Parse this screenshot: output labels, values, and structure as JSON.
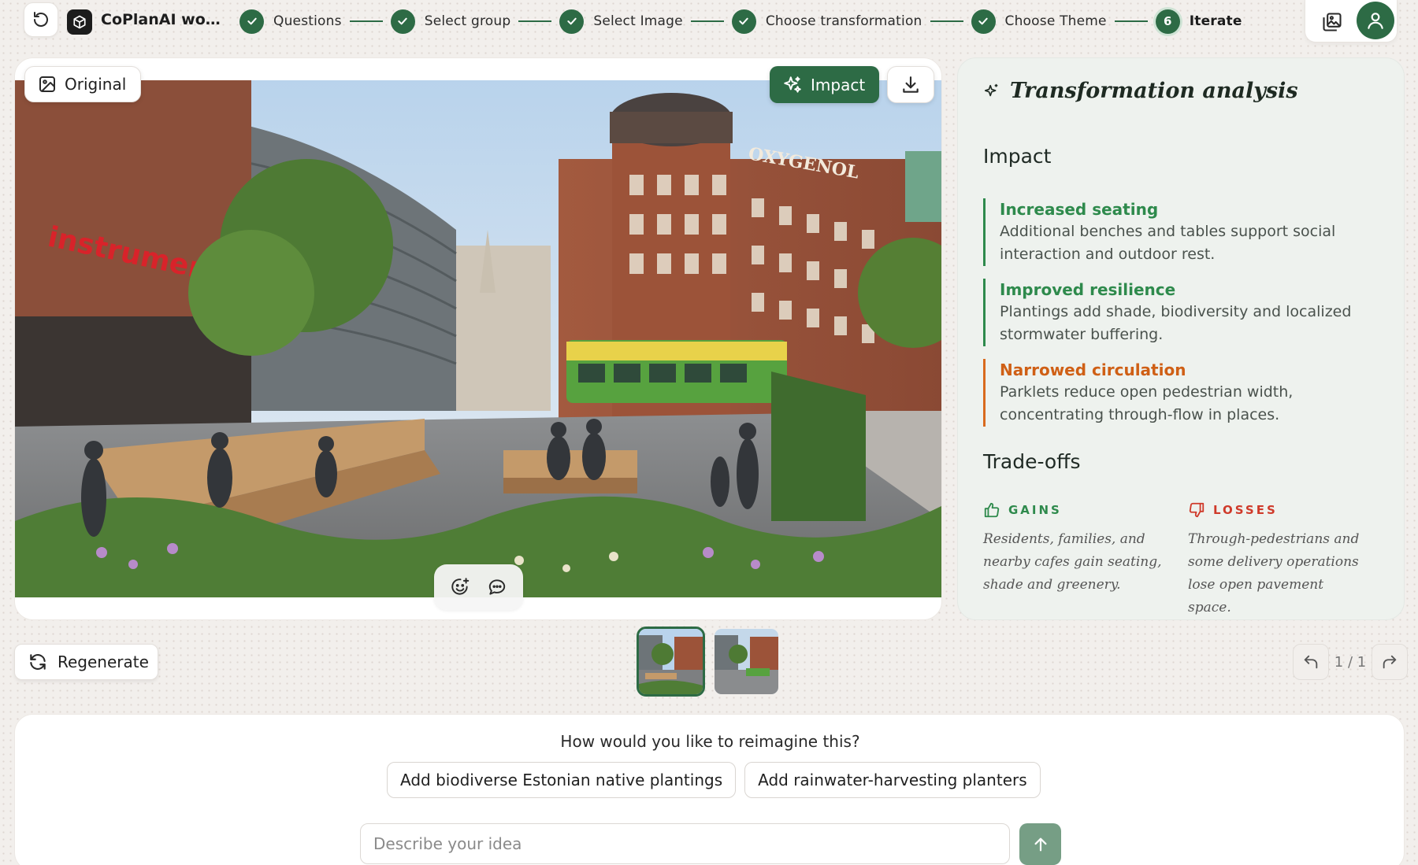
{
  "header": {
    "workspace_title": "CoPlanAI work...",
    "steps": [
      {
        "label": "Questions",
        "done": true
      },
      {
        "label": "Select group",
        "done": true
      },
      {
        "label": "Select Image",
        "done": true
      },
      {
        "label": "Choose transformation",
        "done": true
      },
      {
        "label": "Choose Theme",
        "done": true
      },
      {
        "label": "Iterate",
        "number": "6",
        "current": true
      }
    ],
    "accent_color": "#2d6b45"
  },
  "image_panel": {
    "original_label": "Original",
    "impact_label": "Impact",
    "scene_signs": {
      "shop": "instrumentarium",
      "building": "OXYGENOL"
    }
  },
  "analysis": {
    "title": "Transformation analysis",
    "impact_heading": "Impact",
    "impacts": [
      {
        "title": "Increased seating",
        "description": "Additional benches and tables support social interaction and outdoor rest.",
        "tone": "positive",
        "color": "#2e8a4c"
      },
      {
        "title": "Improved resilience",
        "description": "Plantings add shade, biodiversity and localized stormwater buffering.",
        "tone": "positive",
        "color": "#2e8a4c"
      },
      {
        "title": "Narrowed circulation",
        "description": "Parklets reduce open pedestrian width, concentrating through-flow in places.",
        "tone": "negative",
        "color": "#cf5f15"
      }
    ],
    "tradeoffs_heading": "Trade-offs",
    "gains": {
      "label": "GAINS",
      "text": "Residents, families, and nearby cafes gain seating, shade and greenery."
    },
    "losses": {
      "label": "LOSSES",
      "text": "Through-pedestrians and some delivery operations lose open pavement space."
    }
  },
  "controls": {
    "regenerate_label": "Regenerate",
    "pager": "1 / 1"
  },
  "prompt": {
    "question": "How would you like to reimagine this?",
    "suggestions": [
      "Add biodiverse Estonian native plantings",
      "Add rainwater-harvesting planters"
    ],
    "input_placeholder": "Describe your idea",
    "input_value": ""
  }
}
